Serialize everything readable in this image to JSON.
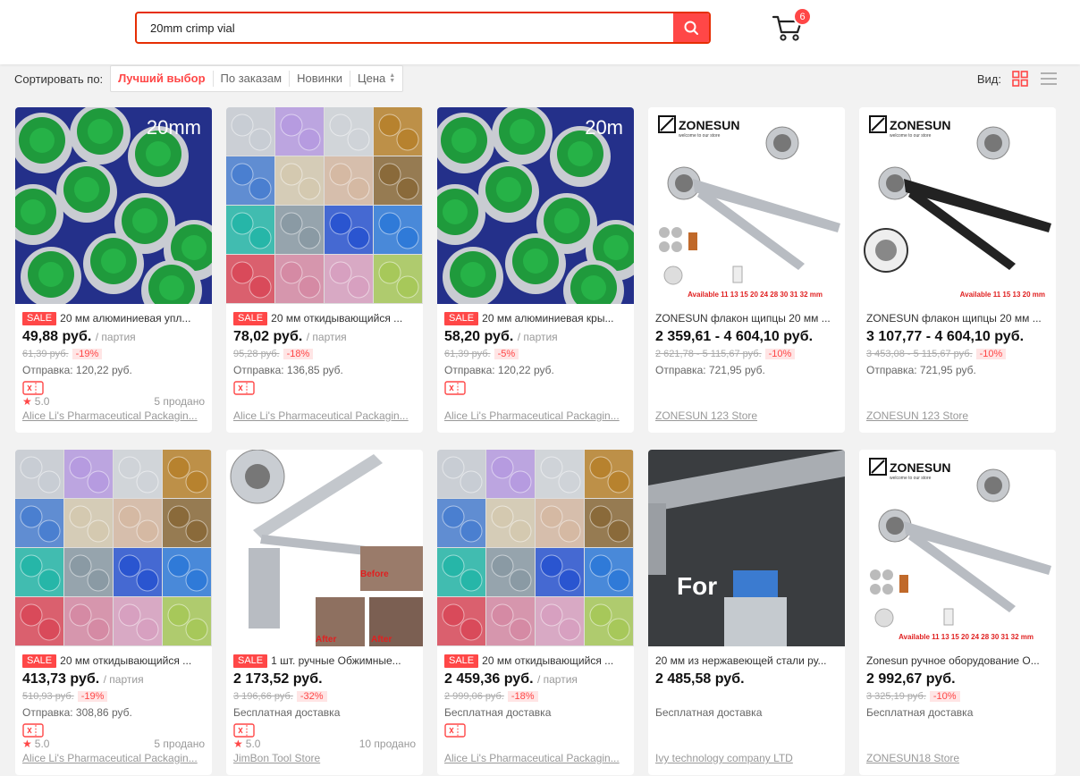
{
  "search": {
    "value": "20mm crimp vial"
  },
  "cart": {
    "count": "6"
  },
  "sort": {
    "label": "Сортировать по:",
    "options": [
      "Лучший выбор",
      "По заказам",
      "Новинки",
      "Цена"
    ],
    "view_label": "Вид:"
  },
  "colors": {
    "accent": "#ff4747",
    "green_cap": "#1e9a3a"
  },
  "products": [
    {
      "sale": "SALE",
      "title": "20 мм алюминиевая упл...",
      "price": "49,88 руб.",
      "unit": "/ партия",
      "orig": "61,39 руб.",
      "disc": "-19%",
      "ship": "Отправка: 120,22 руб.",
      "rating": "5.0",
      "sold": "5 продано",
      "store": "Alice Li's Pharmaceutical Packagin...",
      "image": "green-caps",
      "img_text": "20mm"
    },
    {
      "sale": "SALE",
      "title": "20 мм откидывающийся ...",
      "price": "78,02 руб.",
      "unit": "/ партия",
      "orig": "95,28 руб.",
      "disc": "-18%",
      "ship": "Отправка: 136,85 руб.",
      "rating": "",
      "sold": "",
      "store": "Alice Li's Pharmaceutical Packagin...",
      "image": "color-grid",
      "img_text": ""
    },
    {
      "sale": "SALE",
      "title": "20 мм алюминиевая кры...",
      "price": "58,20 руб.",
      "unit": "/ партия",
      "orig": "61,39 руб.",
      "disc": "-5%",
      "ship": "Отправка: 120,22 руб.",
      "rating": "",
      "sold": "",
      "store": "Alice Li's Pharmaceutical Packagin...",
      "image": "green-caps",
      "img_text": "20m"
    },
    {
      "sale": "",
      "title": "ZONESUN флакон щипцы 20 мм ...",
      "price": "2 359,61 - 4 604,10 руб.",
      "unit": "",
      "orig": "2 621,78 - 5 115,67 руб.",
      "disc": "-10%",
      "ship": "Отправка: 721,95 руб.",
      "rating": "",
      "sold": "",
      "store": "ZONESUN 123 Store",
      "image": "zonesun-silver",
      "img_text": "ZONESUN",
      "img_sub": "welcome to our store",
      "img_avail": "Available 11 13 15 20 24 28 30 31 32 mm"
    },
    {
      "sale": "",
      "title": "ZONESUN флакон щипцы 20 мм ...",
      "price": "3 107,77 - 4 604,10 руб.",
      "unit": "",
      "orig": "3 453,08 - 5 115,67 руб.",
      "disc": "-10%",
      "ship": "Отправка: 721,95 руб.",
      "rating": "",
      "sold": "",
      "store": "ZONESUN 123 Store",
      "image": "zonesun-black",
      "img_text": "ZONESUN",
      "img_sub": "welcome to our store",
      "img_avail": "Available 11 15 13 20 mm"
    },
    {
      "sale": "SALE",
      "title": "20 мм откидывающийся ...",
      "price": "413,73 руб.",
      "unit": "/ партия",
      "orig": "510,93 руб.",
      "disc": "-19%",
      "ship": "Отправка: 308,86 руб.",
      "rating": "5.0",
      "sold": "5 продано",
      "store": "Alice Li's Pharmaceutical Packagin...",
      "image": "color-grid",
      "img_text": ""
    },
    {
      "sale": "SALE",
      "title": "1 шт. ручные Обжимные...",
      "price": "2 173,52 руб.",
      "unit": "",
      "orig": "3 196,66 руб.",
      "disc": "-32%",
      "ship": "Бесплатная доставка",
      "rating": "5.0",
      "sold": "10 продано",
      "store": "JimBon Tool Store",
      "image": "crimper-before",
      "img_text": "Before",
      "img_after": "After"
    },
    {
      "sale": "SALE",
      "title": "20 мм откидывающийся ...",
      "price": "2 459,36 руб.",
      "unit": "/ партия",
      "orig": "2 999,06 руб.",
      "disc": "-18%",
      "ship": "Бесплатная доставка",
      "rating": "",
      "sold": "",
      "store": "Alice Li's Pharmaceutical Packagin...",
      "image": "color-grid",
      "img_text": ""
    },
    {
      "sale": "",
      "title": "20 мм из нержавеющей стали ру...",
      "price": "2 485,58 руб.",
      "unit": "",
      "orig": "",
      "disc": "",
      "ship": "Бесплатная доставка",
      "rating": "",
      "sold": "",
      "store": "Ivy technology company LTD",
      "image": "for-vial",
      "img_text": "For"
    },
    {
      "sale": "",
      "title": "Zonesun ручное оборудование О...",
      "price": "2 992,67 руб.",
      "unit": "",
      "orig": "3 325,19 руб.",
      "disc": "-10%",
      "ship": "Бесплатная доставка",
      "rating": "",
      "sold": "",
      "store": "ZONESUN18 Store",
      "image": "zonesun-silver",
      "img_text": "ZONESUN",
      "img_sub": "welcome to our store",
      "img_avail": "Available 11 13 15 20 24 28 30 31 32 mm"
    }
  ]
}
